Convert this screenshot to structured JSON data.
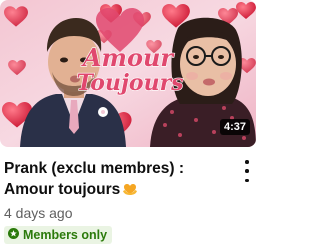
{
  "video": {
    "thumbnail_text_line1": "Amour",
    "thumbnail_text_line2": "Toujours",
    "duration": "4:37",
    "title": "Prank (exclu membres) : Amour toujours",
    "title_emoji": "heart-hands",
    "age": "4 days ago",
    "badge_label": "Members only"
  },
  "colors": {
    "accent_pink": "#e0486e",
    "members_green": "#2b7a0b",
    "members_bg": "#eaf4e3"
  }
}
